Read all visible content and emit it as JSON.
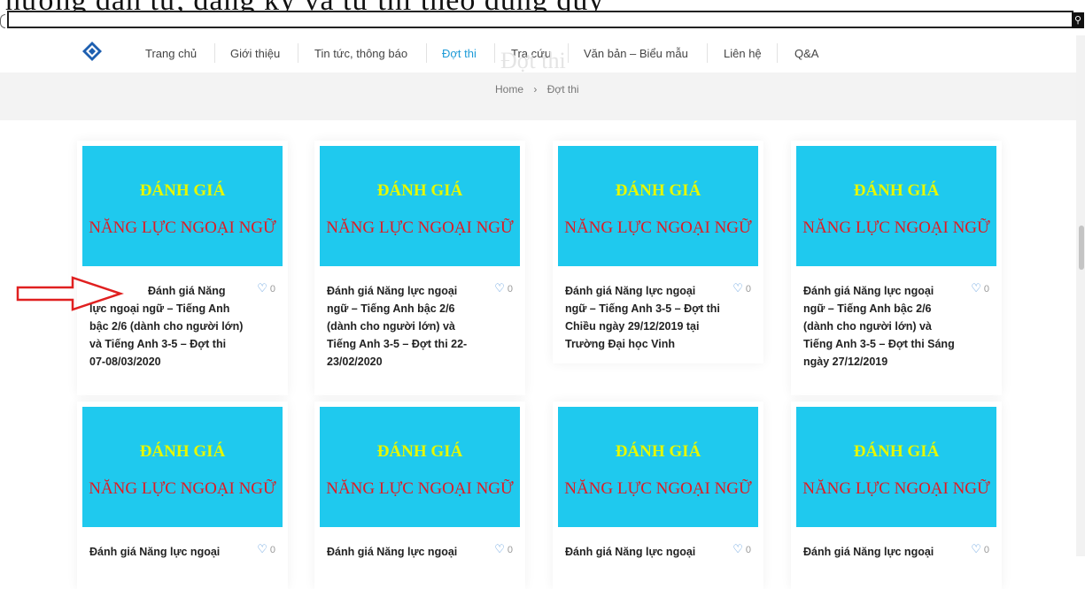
{
  "overlay_text": "hướng dẫn tự, đăng ký và tự thi theo đúng quy",
  "navbar": {
    "items": [
      {
        "label": "Trang chủ"
      },
      {
        "label": "Giới thiệu"
      },
      {
        "label": "Tin tức, thông báo"
      },
      {
        "label": "Đợt thi"
      },
      {
        "label": "Tra cứu"
      },
      {
        "label": "Văn bản – Biểu mẫu"
      },
      {
        "label": "Liên hệ"
      },
      {
        "label": "Q&A"
      }
    ],
    "active_index": 3,
    "ghost_title": "Đợt thi"
  },
  "breadcrumb": {
    "home": "Home",
    "separator": "›",
    "current": "Đợt thi"
  },
  "thumbnail": {
    "line1": "ĐÁNH GIÁ",
    "line2": "NĂNG LỰC NGOẠI NGỮ"
  },
  "cards": [
    {
      "title": "Đánh giá Năng lực ngoại ngữ – Tiếng Anh bậc 2/6 (dành cho người lớn) và Tiếng Anh 3-5 – Đợt thi 07-08/03/2020",
      "likes": "0"
    },
    {
      "title": "Đánh giá Năng lực ngoại ngữ – Tiếng Anh bậc 2/6 (dành cho người lớn) và Tiếng Anh 3-5 – Đợt thi 22-23/02/2020",
      "likes": "0"
    },
    {
      "title": "Đánh giá Năng lực ngoại ngữ – Tiếng Anh 3-5 – Đợt thi Chiều ngày 29/12/2019 tại Trường Đại học Vinh",
      "likes": "0"
    },
    {
      "title": "Đánh giá Năng lực ngoại ngữ – Tiếng Anh bậc 2/6 (dành cho người lớn) và Tiếng Anh 3-5 – Đợt thi Sáng ngày 27/12/2019",
      "likes": "0"
    },
    {
      "title": "Đánh giá Năng lực ngoại",
      "likes": "0"
    },
    {
      "title": "Đánh giá Năng lực ngoại",
      "likes": "0"
    },
    {
      "title": "Đánh giá Năng lực ngoại",
      "likes": "0"
    },
    {
      "title": "Đánh giá Năng lực ngoại",
      "likes": "0"
    }
  ],
  "colors": {
    "accent": "#1e9bd7",
    "thumbnail_bg": "#1fc9ee",
    "thumbnail_line1": "#e6f700",
    "thumbnail_line2": "#e01b22",
    "annotation_arrow": "#e02020"
  }
}
